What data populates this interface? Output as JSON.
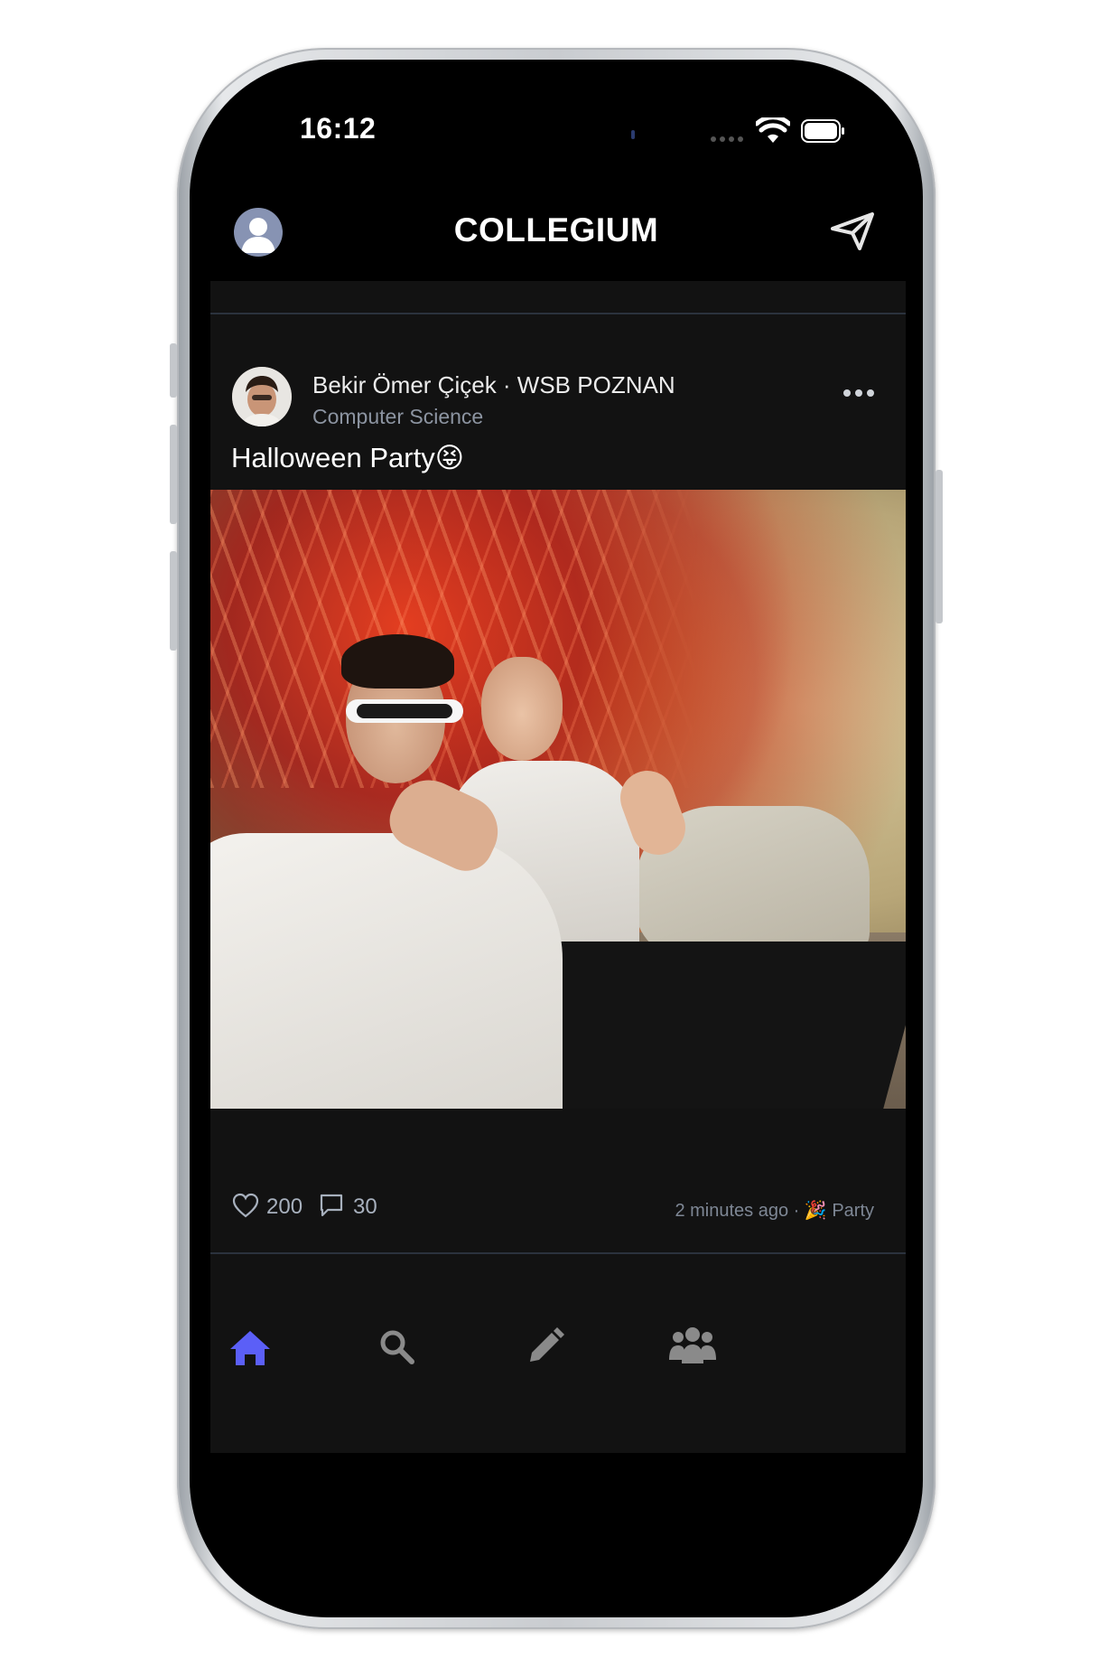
{
  "status_bar": {
    "time": "16:12"
  },
  "header": {
    "title": "COLLEGIUM",
    "left_icon": "profile-avatar-icon",
    "right_icon": "send-icon"
  },
  "post": {
    "author": "Bekir Ömer Çiçek · WSB POZNAN",
    "subtitle": "Computer Science",
    "text": "Halloween Party😝",
    "likes": "200",
    "comments": "30",
    "meta": "2 minutes ago · 🎉 Party",
    "more_icon": "more-options-icon"
  },
  "tab_bar": {
    "active_color": "#5b5ff7",
    "inactive_color": "#8a8a8a",
    "tabs": [
      {
        "icon": "home-icon",
        "active": true
      },
      {
        "icon": "search-icon",
        "active": false
      },
      {
        "icon": "pencil-icon",
        "active": false
      },
      {
        "icon": "groups-icon",
        "active": false
      }
    ]
  },
  "colors": {
    "background": "#000000",
    "feed_background": "#121212",
    "accent": "#5b5ff7",
    "secondary_text": "#8c94a1"
  }
}
